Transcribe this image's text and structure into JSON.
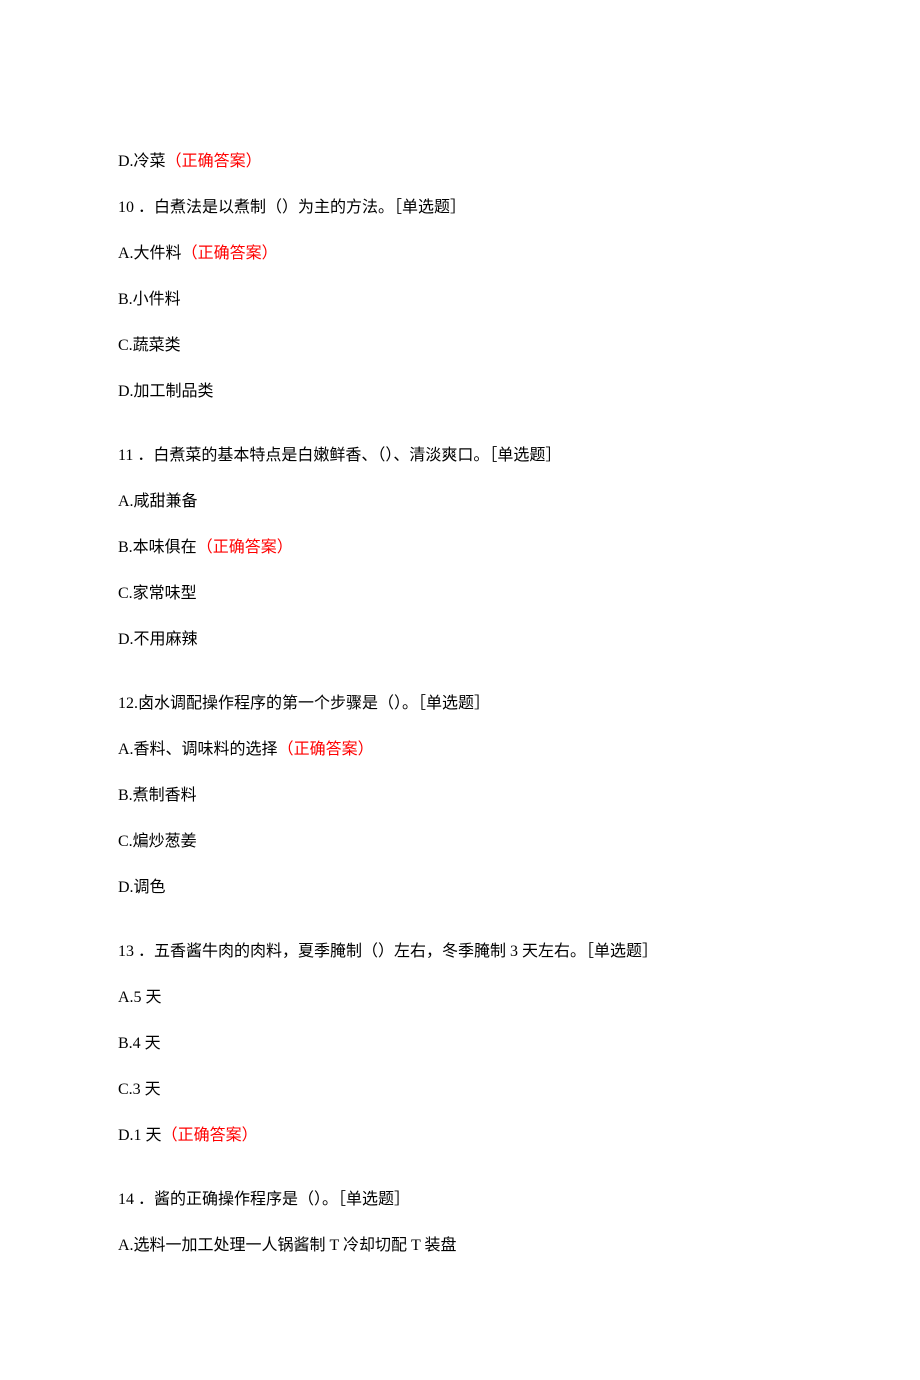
{
  "correct_label": "（正确答案）",
  "q9": {
    "D": "D.冷菜"
  },
  "q10": {
    "stem": "10 ．白煮法是以煮制（）为主的方法。［单选题］",
    "A": "A.大件料",
    "B": "B.小件料",
    "C": "C.蔬菜类",
    "D": "D.加工制品类"
  },
  "q11": {
    "stem": "11 ．白煮菜的基本特点是白嫩鲜香、（）、清淡爽口。［单选题］",
    "A": "A.咸甜兼备",
    "B": "B.本味俱在",
    "C": "C.家常味型",
    "D": "D.不用麻辣"
  },
  "q12": {
    "stem": "12.卤水调配操作程序的第一个步骤是（）。［单选题］",
    "A": "A.香料、调味料的选择",
    "B": "B.煮制香料",
    "C": "C.煸炒葱姜",
    "D": "D.调色"
  },
  "q13": {
    "stem": "13 ．五香酱牛肉的肉料，夏季腌制（）左右，冬季腌制 3 天左右。［单选题］",
    "A": "A.5 天",
    "B": "B.4 天",
    "C": "C.3 天",
    "D": "D.1 天"
  },
  "q14": {
    "stem": "14 ．酱的正确操作程序是（）。［单选题］",
    "A": "A.选料一加工处理一人锅酱制 T 冷却切配 T 装盘"
  }
}
